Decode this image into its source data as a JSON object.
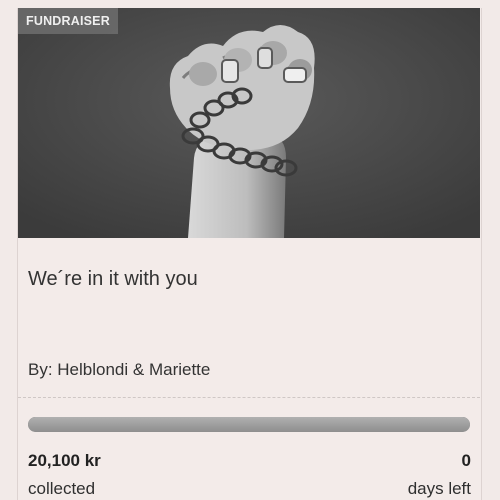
{
  "badge": {
    "label": "FUNDRAISER"
  },
  "hero": {
    "image": "raised-fist-chain-photo"
  },
  "fundraiser": {
    "title": "We´re in it with you",
    "author": "By: Helblondi & Mariette"
  },
  "progress": {
    "fraction": 1.0
  },
  "stats": {
    "collected_value": "20,100 kr",
    "collected_label": "collected",
    "days_value": "0",
    "days_label": "days left"
  },
  "colors": {
    "page_bg": "#f2eae8",
    "badge_bg": "#6c6c6c",
    "progress": "#9b9b9b"
  }
}
